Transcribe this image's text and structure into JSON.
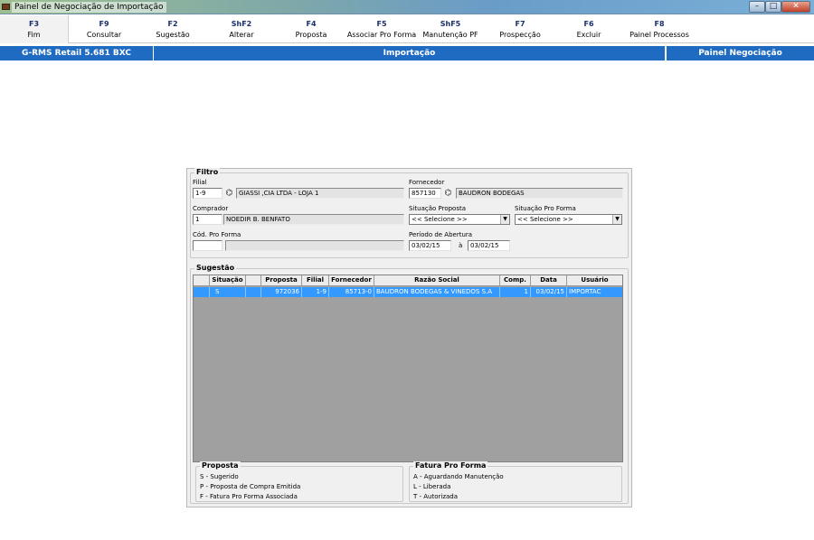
{
  "window": {
    "title": "Painel de Negociação de Importação",
    "min_glyph": "–",
    "max_glyph": "□",
    "close_glyph": "✕"
  },
  "toolbar": {
    "keys": [
      {
        "key": "F3",
        "label": "Fim"
      },
      {
        "key": "F9",
        "label": "Consultar"
      },
      {
        "key": "F2",
        "label": "Sugestão"
      },
      {
        "key": "ShF2",
        "label": "Alterar"
      },
      {
        "key": "F4",
        "label": "Proposta"
      },
      {
        "key": "F5",
        "label": "Associar Pro Forma"
      },
      {
        "key": "ShF5",
        "label": "Manutenção PF"
      },
      {
        "key": "F7",
        "label": "Prospecção"
      },
      {
        "key": "F6",
        "label": "Excluir"
      },
      {
        "key": "F8",
        "label": "Painel Processos"
      }
    ]
  },
  "statusbar": {
    "version": "G-RMS Retail 5.681 BXC",
    "module": "Importação",
    "screen": "Painel Negociação"
  },
  "filtro": {
    "title": "Filtro",
    "filial_label": "Filial",
    "filial_value": "1-9",
    "filial_desc": "GIASSI ,CIA LTDA - LOJA 1",
    "fornecedor_label": "Fornecedor",
    "fornecedor_value": "857130",
    "fornecedor_desc": "BAUDRON BODEGAS",
    "comprador_label": "Comprador",
    "comprador_value": "1",
    "comprador_desc": "NOEDIR B. BENFATO",
    "situacao_proposta_label": "Situação Proposta",
    "situacao_proposta_value": "<< Selecione >>",
    "situacao_proforma_label": "Situação Pro Forma",
    "situacao_proforma_value": "<< Selecione >>",
    "cod_proforma_label": "Cód. Pro Forma",
    "cod_proforma_value": "",
    "periodo_label": "Período de Abertura",
    "periodo_de": "03/02/15",
    "periodo_sep": "à",
    "periodo_ate": "03/02/15"
  },
  "sugestao": {
    "title": "Sugestão",
    "columns": [
      "",
      "Situação",
      "",
      "Proposta",
      "Filial",
      "Fornecedor",
      "Razão Social",
      "Comp.",
      "Data",
      "Usuário"
    ],
    "rows": [
      [
        "",
        "S",
        "",
        "972036",
        "1-9",
        "85713-0",
        "BAUDRON BODEGAS & VINEDOS S.A",
        "1",
        "03/02/15",
        "IMPORTAC"
      ]
    ]
  },
  "legend": {
    "proposta_title": "Proposta",
    "proposta_items": [
      "S - Sugerido",
      "P - Proposta de Compra Emitida",
      "F - Fatura Pro Forma Associada"
    ],
    "fatura_title": "Fatura Pro Forma",
    "fatura_items": [
      "A - Aguardando Manutenção",
      "L - Liberada",
      "T - Autorizada"
    ]
  }
}
